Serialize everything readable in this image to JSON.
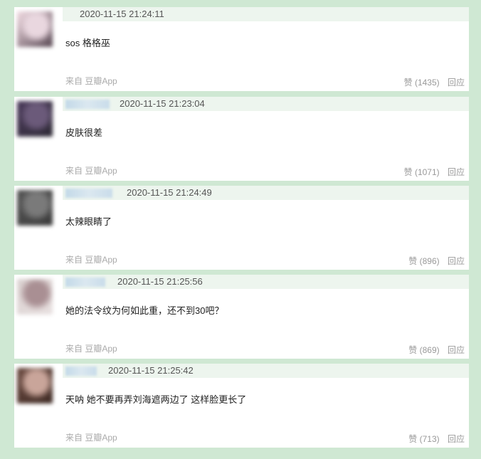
{
  "comments": [
    {
      "time": "2020-11-15 21:24:11",
      "text": "sos 格格巫",
      "source": "来自 豆瓣App",
      "like": "赞 (1435)",
      "reply": "回应",
      "avatar_colors": [
        "#f2dce3",
        "#e9d7df",
        "#5a4a55"
      ]
    },
    {
      "time": "2020-11-15 21:23:04",
      "text": "皮肤很差",
      "source": "来自 豆瓣App",
      "like": "赞 (1071)",
      "reply": "回应",
      "avatar_colors": [
        "#4a3a5a",
        "#6b5a7a",
        "#2e2a35"
      ]
    },
    {
      "time": "2020-11-15 21:24:49",
      "text": "太辣眼睛了",
      "source": "来自 豆瓣App",
      "like": "赞 (896)",
      "reply": "回应",
      "avatar_colors": [
        "#555555",
        "#7a7a7a",
        "#3a3a3a"
      ]
    },
    {
      "time": "2020-11-15 21:25:56",
      "text": "她的法令纹为何如此重，还不到30吧？",
      "source": "来自 豆瓣App",
      "like": "赞 (869)",
      "reply": "回应",
      "avatar_colors": [
        "#d9d0cf",
        "#a98f93",
        "#e8e0e0"
      ]
    },
    {
      "time": "2020-11-15 21:25:42",
      "text": "天呐 她不要再弄刘海遮两边了 这样脸更长了",
      "source": "来自 豆瓣App",
      "like": "赞 (713)",
      "reply": "回应",
      "avatar_colors": [
        "#6b4a40",
        "#c9a59a",
        "#3e2a24"
      ]
    }
  ]
}
